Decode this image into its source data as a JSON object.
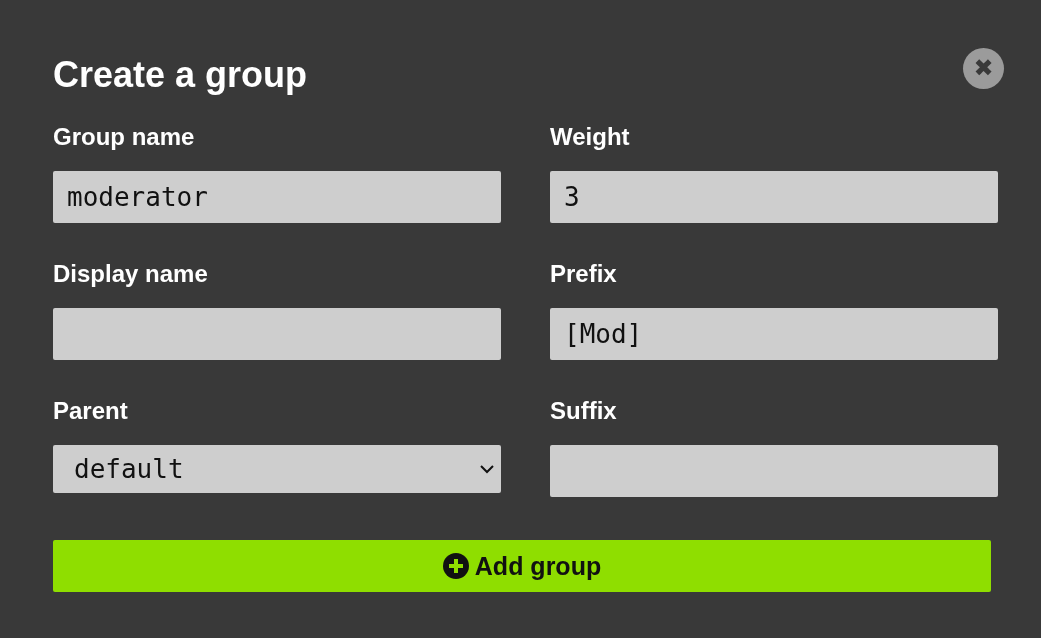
{
  "dialog": {
    "title": "Create a group",
    "close": {
      "glyph": "✖"
    },
    "fields": [
      {
        "kind": "text",
        "label": "Group name",
        "value": "moderator"
      },
      {
        "kind": "text",
        "label": "Weight",
        "value": "3"
      },
      {
        "kind": "text",
        "label": "Display name"
      },
      {
        "kind": "text",
        "label": "Prefix",
        "value": "[Mod]"
      },
      {
        "kind": "select",
        "label": "Parent",
        "value": "default"
      },
      {
        "kind": "text",
        "label": "Suffix"
      }
    ],
    "submit": {
      "label": "Add group"
    }
  }
}
